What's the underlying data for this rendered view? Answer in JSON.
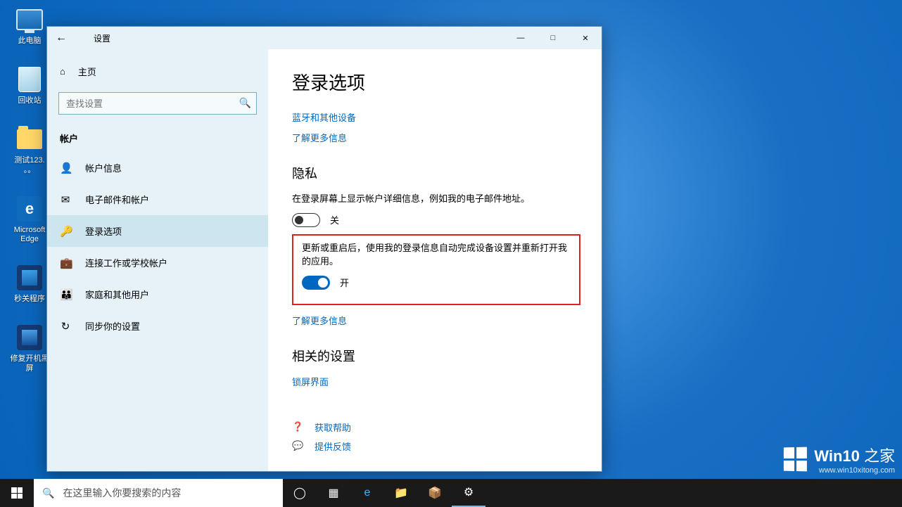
{
  "desktop": {
    "icons": [
      {
        "name": "this-pc",
        "label": "此电脑"
      },
      {
        "name": "recycle-bin",
        "label": "回收站"
      },
      {
        "name": "test-folder",
        "label": "测试123. 。。"
      },
      {
        "name": "edge",
        "label": "Microsoft Edge"
      },
      {
        "name": "sec-close",
        "label": "秒关程序"
      },
      {
        "name": "fix-boot",
        "label": "修复开机黑屏"
      }
    ]
  },
  "settings": {
    "titlebar": {
      "title": "设置"
    },
    "sidebar": {
      "home": "主页",
      "search_placeholder": "查找设置",
      "category": "帐户",
      "items": [
        {
          "icon": "person-icon",
          "label": "帐户信息"
        },
        {
          "icon": "mail-icon",
          "label": "电子邮件和帐户"
        },
        {
          "icon": "key-icon",
          "label": "登录选项",
          "active": true
        },
        {
          "icon": "briefcase-icon",
          "label": "连接工作或学校帐户"
        },
        {
          "icon": "family-icon",
          "label": "家庭和其他用户"
        },
        {
          "icon": "sync-icon",
          "label": "同步你的设置"
        }
      ]
    },
    "main": {
      "heading": "登录选项",
      "link_bluetooth": "蓝牙和其他设备",
      "link_learn_more_1": "了解更多信息",
      "privacy_heading": "隐私",
      "privacy_desc": "在登录屏幕上显示帐户详细信息，例如我的电子邮件地址。",
      "toggle1_state": "关",
      "highlight_desc": "更新或重启后，使用我的登录信息自动完成设备设置并重新打开我的应用。",
      "toggle2_state": "开",
      "link_learn_more_2": "了解更多信息",
      "related_heading": "相关的设置",
      "link_lockscreen": "锁屏界面",
      "help_get": "获取帮助",
      "help_feedback": "提供反馈"
    }
  },
  "taskbar": {
    "search_placeholder": "在这里输入你要搜索的内容"
  },
  "watermark": {
    "brand1": "Win10",
    "brand2": "之家",
    "url": "www.win10xitong.com"
  }
}
